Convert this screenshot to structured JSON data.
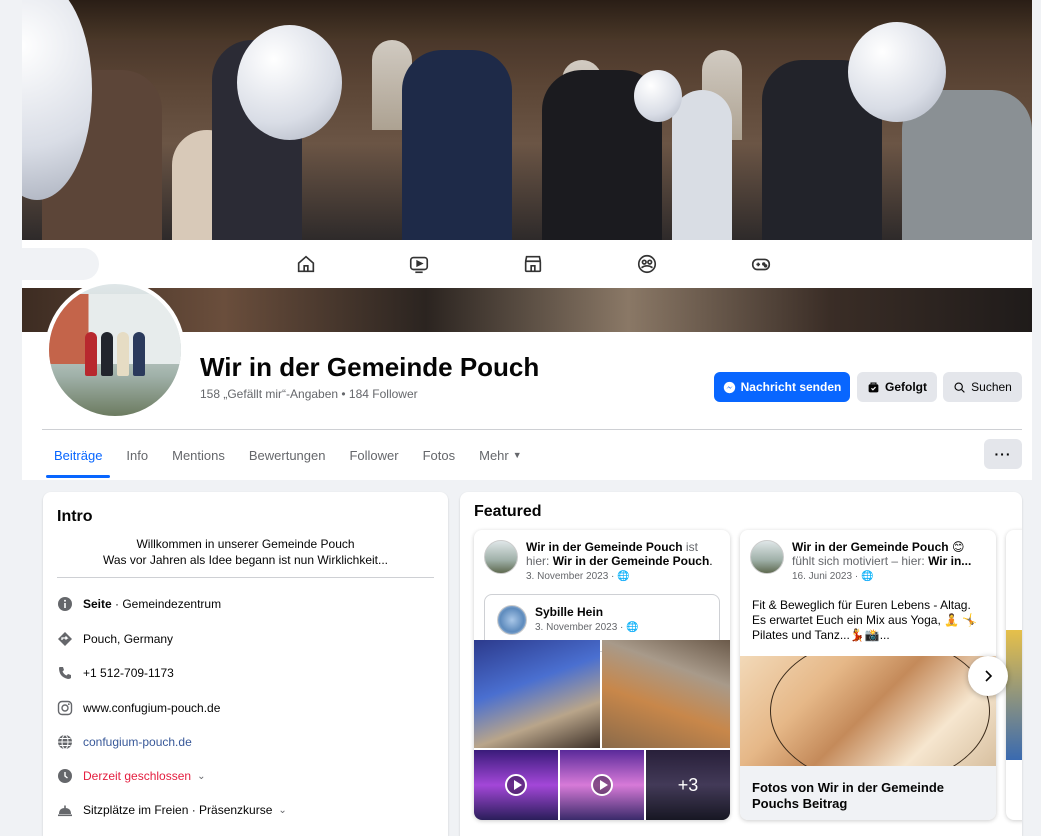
{
  "page": {
    "name": "Wir in der Gemeinde Pouch",
    "stats": "158 „Gefällt mir“-Angaben • 184 Follower"
  },
  "actions": {
    "message": "Nachricht senden",
    "following": "Gefolgt",
    "search": "Suchen",
    "more": "···"
  },
  "top_nav": {
    "icons": [
      "home-icon",
      "video-icon",
      "marketplace-icon",
      "groups-icon",
      "gaming-icon"
    ]
  },
  "tabs": [
    {
      "label": "Beiträge",
      "active": true
    },
    {
      "label": "Info"
    },
    {
      "label": "Mentions"
    },
    {
      "label": "Bewertungen"
    },
    {
      "label": "Follower"
    },
    {
      "label": "Fotos"
    },
    {
      "label": "Mehr"
    }
  ],
  "intro": {
    "title": "Intro",
    "bio_line1": "Willkommen in unserer Gemeinde Pouch",
    "bio_line2": "Was vor Jahren als Idee begann ist nun Wirklichkeit...",
    "category_label": "Seite",
    "category": " · Gemeindezentrum",
    "location": "Pouch, Germany",
    "phone": "+1 512-709-1173",
    "instagram": "www.confugium-pouch.de",
    "website": "confugium-pouch.de",
    "hours": "Derzeit geschlossen",
    "services": "Sitzplätze im Freien · Präsenzkurse"
  },
  "featured": {
    "title": "Featured",
    "post1": {
      "author": "Wir in der Gemeinde Pouch",
      "is_here": " ist hier: ",
      "place": "Wir in der Gemeinde Pouch",
      "period": ".",
      "date": "3. November 2023 · ",
      "shared_author": "Sybille Hein",
      "shared_date": "3. November 2023 · ",
      "more_count": "+3"
    },
    "post2": {
      "author": "Wir in der Gemeinde Pouch",
      "feeling": "fühlt sich motiviert – hier: ",
      "place": "Wir in...",
      "date": "16. Juni 2023 · ",
      "text": "Fit & Beweglich für Euren Lebens - Altag. Es erwartet Euch ein Mix aus Yoga, 🧘 🤸Pilates und Tanz...💃📸...",
      "caption": "Fotos von Wir in der Gemeinde Pouchs Beitrag"
    }
  },
  "colors": {
    "primary": "#0866ff",
    "background": "#f0f2f5",
    "closed": "#e41e3f",
    "link": "#385898"
  }
}
